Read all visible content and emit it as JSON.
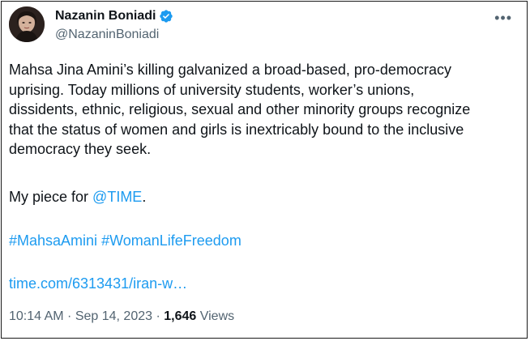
{
  "author": {
    "display_name": "Nazanin Boniadi",
    "handle": "@NazaninBoniadi",
    "verified": true
  },
  "tweet": {
    "text_line1": "Mahsa Jina Amini’s killing galvanized a broad-based, pro-democracy",
    "text_line2": "uprising. Today millions of university students, worker’s unions,",
    "text_line3": "dissidents, ethnic, religious, sexual and other minority groups recognize",
    "text_line4": "that the status of women and girls is inextricably bound to the inclusive",
    "text_line5": "democracy they seek.",
    "piece_prefix": "My piece for ",
    "mention": "@TIME",
    "piece_suffix": ".",
    "hashtag1": "#MahsaAmini",
    "hashtag2": "#WomanLifeFreedom",
    "link": "time.com/6313431/iran-w…"
  },
  "meta": {
    "time": "10:14 AM",
    "separator": " · ",
    "date": "Sep 14, 2023",
    "views_count": "1,646",
    "views_label": " Views"
  },
  "icons": {
    "verified": "verified-badge-icon",
    "more": "more-options-icon"
  },
  "colors": {
    "link": "#1d9bf0",
    "secondary_text": "#536471",
    "primary_text": "#0f1419"
  }
}
